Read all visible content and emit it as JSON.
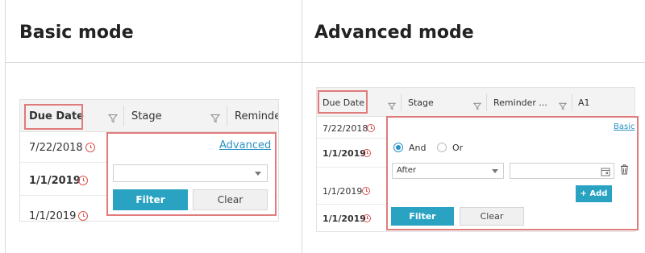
{
  "headings": {
    "basic": "Basic mode",
    "advanced": "Advanced mode"
  },
  "basic": {
    "columns": [
      "Due Date",
      "Stage",
      "Reminder"
    ],
    "rows": [
      "7/22/2018",
      "1/1/2019",
      "1/1/2019"
    ],
    "panel": {
      "mode_link": "Advanced",
      "filter_label": "Filter",
      "clear_label": "Clear",
      "select_value": ""
    }
  },
  "advanced": {
    "columns": [
      "Due Date",
      "Stage",
      "Reminder ...",
      "A1"
    ],
    "rows": [
      "7/22/2018",
      "1/1/2019",
      "1/1/2019",
      "1/1/2019"
    ],
    "panel": {
      "mode_link": "Basic",
      "and_label": "And",
      "or_label": "Or",
      "operator_value": "After",
      "date_value": "",
      "add_label": "+ Add",
      "filter_label": "Filter",
      "clear_label": "Clear"
    }
  },
  "colors": {
    "accent": "#2aa3c2",
    "highlight": "#e07b7b",
    "link": "#2a91c4",
    "clock": "#d9534f"
  },
  "icons": [
    "filter-icon",
    "clock-icon",
    "calendar-icon",
    "trash-icon",
    "chevron-down-icon",
    "radio-icon"
  ]
}
